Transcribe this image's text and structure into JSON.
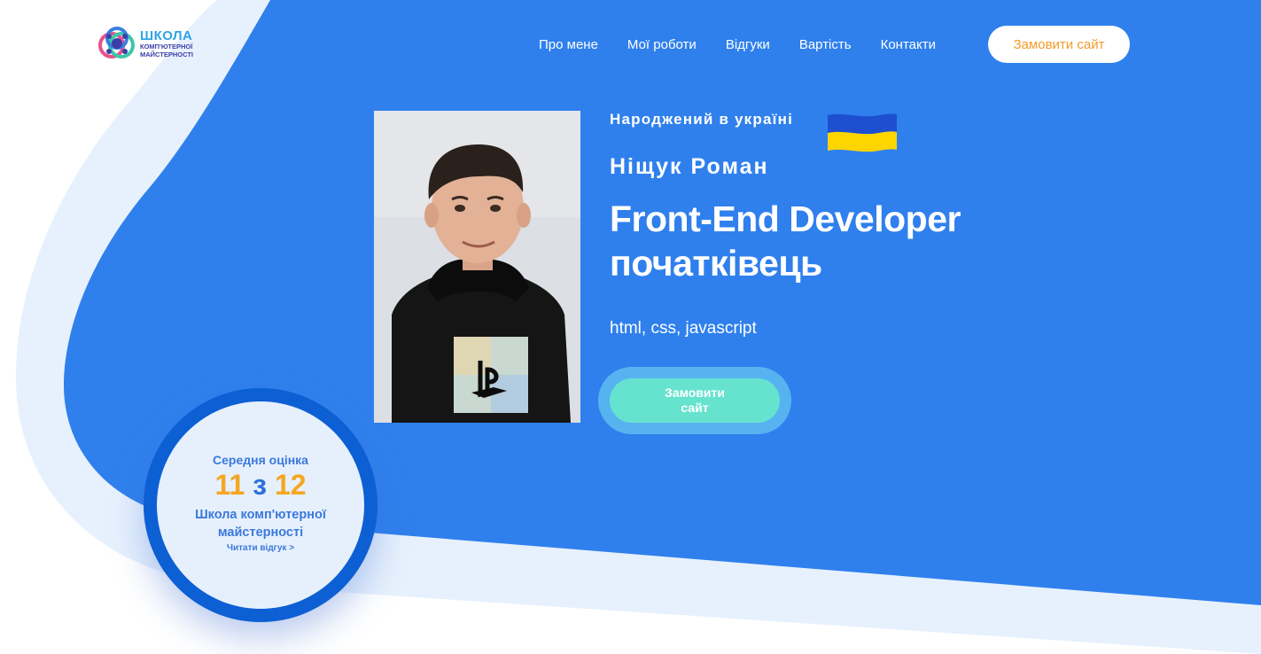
{
  "logo": {
    "title": "ШКОЛА",
    "subtitle_line1": "КОМП'ЮТЕРНОЇ",
    "subtitle_line2": "МАЙСТЕРНОСТІ"
  },
  "nav": {
    "items": [
      "Про мене",
      "Мої роботи",
      "Відгуки",
      "Вартість",
      "Контакти"
    ],
    "cta": "Замовити сайт"
  },
  "hero": {
    "born": "Народжений в україні",
    "name": "Ніщук Роман",
    "headline_line1": "Front-End Developer",
    "headline_line2": "початківець",
    "skills": "html, css, javascript",
    "cta_line1": "Замовити",
    "cta_line2": "сайт"
  },
  "rating": {
    "label": "Середня оцінка",
    "score": "11",
    "of": "з",
    "max": "12",
    "school_line1": "Школа комп'ютерної",
    "school_line2": "майстерності",
    "link": "Читати відгук >"
  },
  "colors": {
    "hero_blue": "#2f80ed",
    "light_band": "#e7f1fd",
    "accent_orange": "#f39c2a",
    "cta_mint": "#66e3cf",
    "flag_blue": "#1e4fd0",
    "flag_yellow": "#ffd500"
  }
}
